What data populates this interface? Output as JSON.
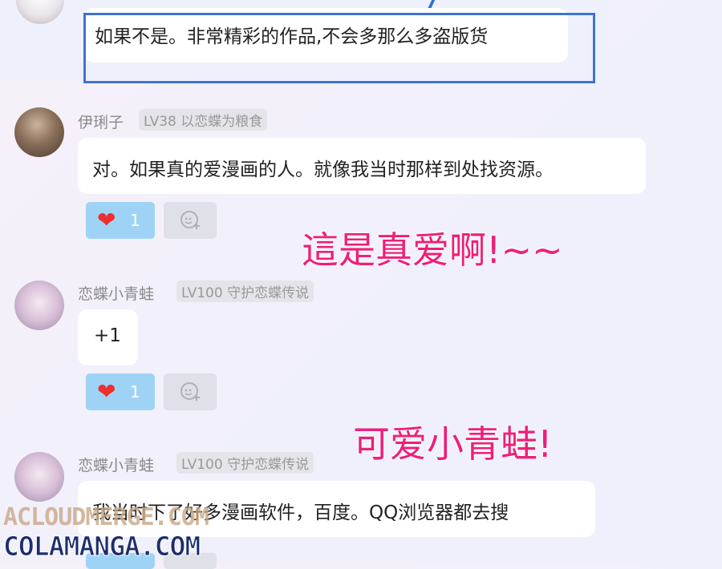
{
  "top_comment": {
    "text": "如果不是。非常精彩的作品,不会多那么多盗版货"
  },
  "comments": [
    {
      "username": "伊琍子",
      "badge": "LV38 以恋蝶为粮食",
      "text": "对。如果真的爱漫画的人。就像我当时那样到处找资源。",
      "likes": "1"
    },
    {
      "username": "恋蝶小青蛙",
      "badge": "LV100 守护恋蝶传说",
      "text": "+1",
      "likes": "1"
    },
    {
      "username": "恋蝶小青蛙",
      "badge": "LV100 守护恋蝶传说",
      "text": "我当时下了好多漫画软件，百度。QQ浏览器都去搜"
    }
  ],
  "annotations": {
    "first": "這是真爱啊!~~",
    "second": "可爱小青蛙!"
  },
  "watermark": {
    "line1": "ACLOUDMERGE.COM",
    "line2": "COLAMANGA.COM"
  },
  "icons": {
    "like": "heart-icon",
    "reply": "comment-plus-icon"
  },
  "colors": {
    "like_bg": "#9fd3f6",
    "heart": "#ef2e2e",
    "annotation": "#f01e7a",
    "highlight_border": "#3f73cf"
  }
}
